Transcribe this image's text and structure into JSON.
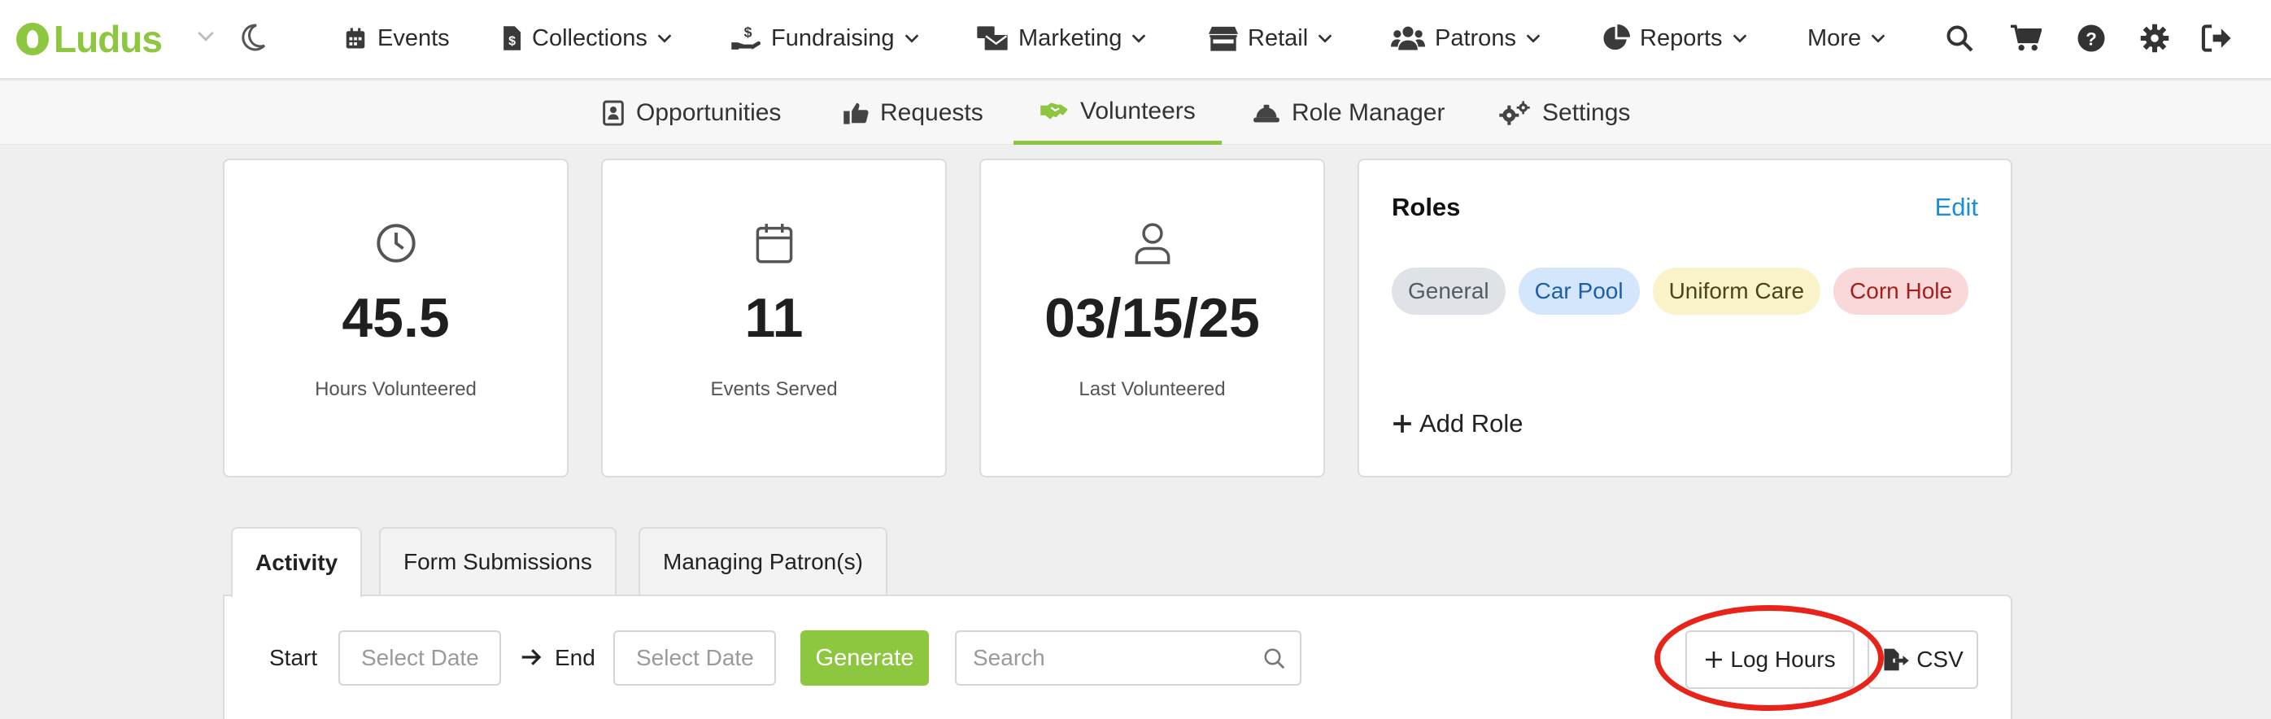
{
  "app": {
    "logo_text": "Ludus",
    "brand_color": "#8dc63f"
  },
  "topnav": {
    "items": [
      {
        "label": "Events",
        "icon": "calendar-icon"
      },
      {
        "label": "Collections",
        "icon": "file-dollar-icon"
      },
      {
        "label": "Fundraising",
        "icon": "hand-dollar-icon"
      },
      {
        "label": "Marketing",
        "icon": "mail-bulk-icon"
      },
      {
        "label": "Retail",
        "icon": "store-icon"
      },
      {
        "label": "Patrons",
        "icon": "users-icon"
      },
      {
        "label": "Reports",
        "icon": "pie-chart-icon"
      },
      {
        "label": "More",
        "icon": ""
      }
    ],
    "utility_icons": [
      "search-icon",
      "cart-icon",
      "help-icon",
      "gear-icon",
      "sign-out-icon"
    ]
  },
  "subnav": {
    "items": [
      {
        "label": "Opportunities",
        "icon": "address-card-icon"
      },
      {
        "label": "Requests",
        "icon": "thumbs-up-icon"
      },
      {
        "label": "Volunteers",
        "icon": "handshake-icon",
        "active": true
      },
      {
        "label": "Role Manager",
        "icon": "hard-hat-icon"
      },
      {
        "label": "Settings",
        "icon": "gears-icon"
      }
    ]
  },
  "stats": [
    {
      "value": "45.5",
      "caption": "Hours Volunteered",
      "icon": "clock-icon"
    },
    {
      "value": "11",
      "caption": "Events Served",
      "icon": "calendar-icon"
    },
    {
      "value": "03/15/25",
      "caption": "Last Volunteered",
      "icon": "user-icon"
    }
  ],
  "roles": {
    "title": "Roles",
    "edit_label": "Edit",
    "add_label": "Add Role",
    "chips": [
      {
        "label": "General",
        "bg": "#dfe3e8",
        "fg": "#555b63"
      },
      {
        "label": "Car Pool",
        "bg": "#d3e6fb",
        "fg": "#1d5ea8"
      },
      {
        "label": "Uniform Care",
        "bg": "#faf3c9",
        "fg": "#4a4419"
      },
      {
        "label": "Corn Hole",
        "bg": "#f8d8d8",
        "fg": "#a51f1f"
      }
    ]
  },
  "tabs": [
    {
      "label": "Activity",
      "active": true
    },
    {
      "label": "Form Submissions"
    },
    {
      "label": "Managing Patron(s)"
    }
  ],
  "filters": {
    "start_label": "Start",
    "start_placeholder": "Select Date",
    "end_label": "End",
    "end_placeholder": "Select Date",
    "generate_label": "Generate",
    "search_placeholder": "Search",
    "log_hours_label": "Log Hours",
    "csv_label": "CSV"
  },
  "colors": {
    "accent": "#8dc63f",
    "link": "#1b8ed6",
    "annotation_ring": "#e8231a"
  }
}
